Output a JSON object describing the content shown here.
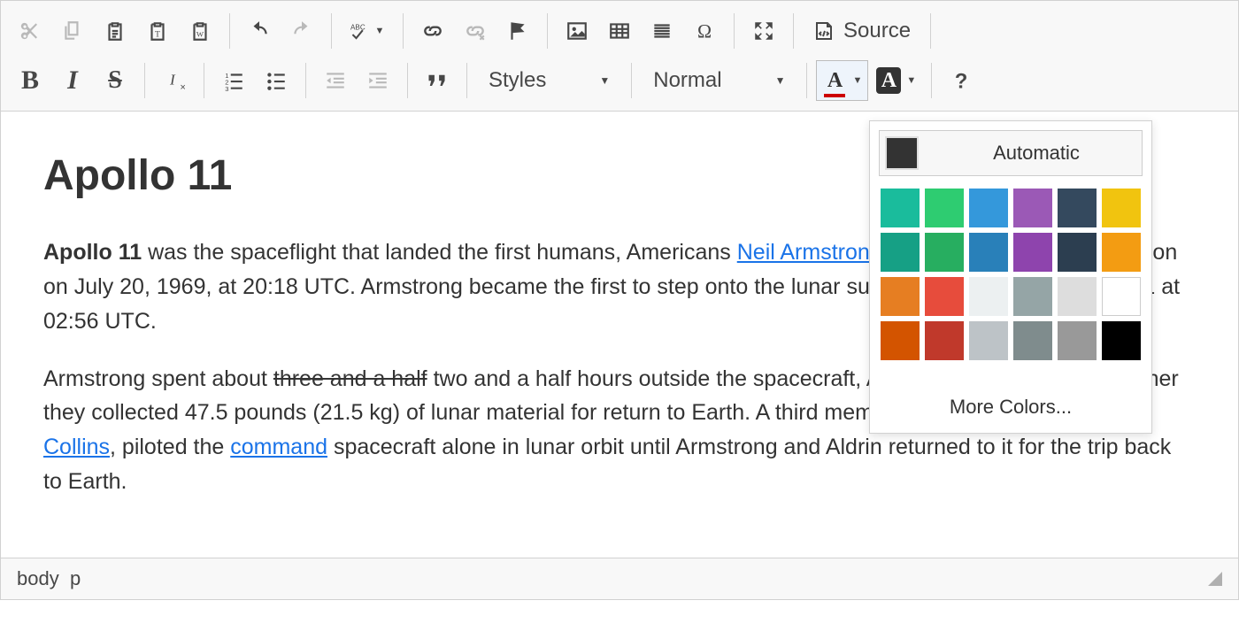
{
  "toolbar": {
    "source_label": "Source",
    "styles_combo": "Styles",
    "format_combo": "Normal"
  },
  "color_panel": {
    "automatic_label": "Automatic",
    "auto_swatch": "#333333",
    "colors": [
      "#1abc9c",
      "#2ecc71",
      "#3498db",
      "#9b59b6",
      "#34495e",
      "#f1c40f",
      "#16a085",
      "#27ae60",
      "#2980b9",
      "#8e44ad",
      "#2c3e50",
      "#f39c12",
      "#e67e22",
      "#e74c3c",
      "#ecf0f1",
      "#95a5a6",
      "#dddddd",
      "#ffffff",
      "#d35400",
      "#c0392b",
      "#bdc3c7",
      "#7f8c8d",
      "#999999",
      "#000000"
    ],
    "more_label": "More Colors..."
  },
  "document": {
    "title": "Apollo 11",
    "p1": {
      "strong": "Apollo 11",
      "t1": " was the spaceflight that landed the first humans, Americans ",
      "link1": "Neil Armstrong",
      "t2": " and Buzz Aldrin, on the Moon on July 20, 1969, at 20:18 UTC. Armstrong became the first to step onto the lunar surface 6 hours later on July 21 at 02:56 UTC."
    },
    "p2": {
      "t1": "Armstrong spent about ",
      "struck": "three and a half",
      "t2": " two and a half hours outside the spacecraft, Aldrin slightly less; and together they collected 47.5 pounds (21.5 kg) of lunar material for return to Earth. A third member of the mission, ",
      "link1": "Michael Collins",
      "t3": ", piloted the ",
      "link2": "command",
      "t4": " spacecraft alone in lunar orbit until Armstrong and Aldrin returned to it for the trip back to Earth."
    }
  },
  "statusbar": {
    "path1": "body",
    "path2": "p"
  }
}
